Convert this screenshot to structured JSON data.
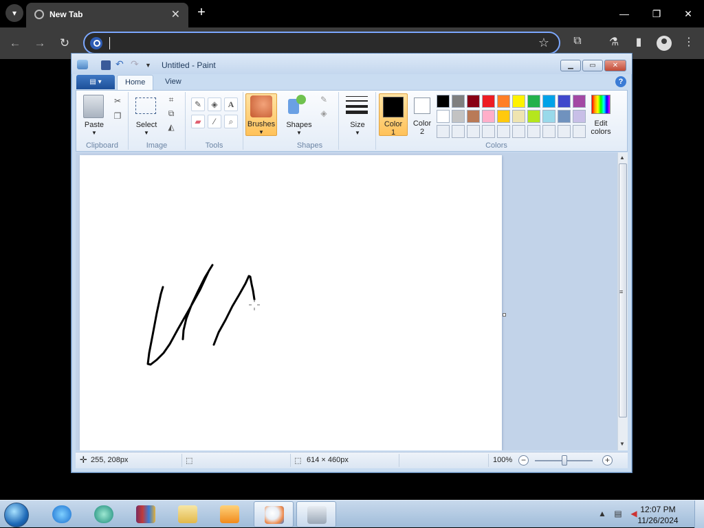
{
  "browser": {
    "tab_title": "New Tab",
    "omnibox_placeholder": "",
    "icons": [
      "tab-search-icon",
      "chrome-favicon",
      "close-icon",
      "plus-icon",
      "back-icon",
      "forward-icon",
      "reload-icon",
      "star-icon",
      "extensions-icon",
      "labs-icon",
      "side-panel-icon",
      "profile-icon",
      "kebab-menu-icon"
    ]
  },
  "paint": {
    "title": "Untitled - Paint",
    "tabs": {
      "home": "Home",
      "view": "View"
    },
    "groups": {
      "clipboard": {
        "label": "Clipboard",
        "paste": "Paste"
      },
      "image": {
        "label": "Image",
        "select": "Select"
      },
      "tools": {
        "label": "Tools"
      },
      "brushes": "Brushes",
      "shapes": {
        "label": "Shapes",
        "button": "Shapes"
      },
      "size": "Size",
      "colors": {
        "label": "Colors",
        "color1": "Color",
        "color1_num": "1",
        "color2": "Color",
        "color2_num": "2",
        "edit_line1": "Edit",
        "edit_line2": "colors",
        "palette_row1": [
          "#000000",
          "#7f7f7f",
          "#880015",
          "#ed1c24",
          "#ff7f27",
          "#fff200",
          "#22b14c",
          "#00a2e8",
          "#3f48cc",
          "#a349a4"
        ],
        "palette_row2": [
          "#ffffff",
          "#c3c3c3",
          "#b97a57",
          "#ffaec9",
          "#ffc90e",
          "#efe4b0",
          "#b5e61d",
          "#99d9ea",
          "#7092be",
          "#c8bfe7"
        ]
      }
    },
    "status": {
      "cursor_pos": "255, 208px",
      "selection_size": "",
      "canvas_size": "614 × 460px",
      "zoom": "100%"
    }
  },
  "taskbar": {
    "time": "12:07 PM",
    "date": "11/26/2024",
    "apps": [
      "ie-icon",
      "media-center-icon",
      "winrar-icon",
      "explorer-icon",
      "media-player-icon",
      "paint-icon",
      "generic-app-icon"
    ]
  }
}
